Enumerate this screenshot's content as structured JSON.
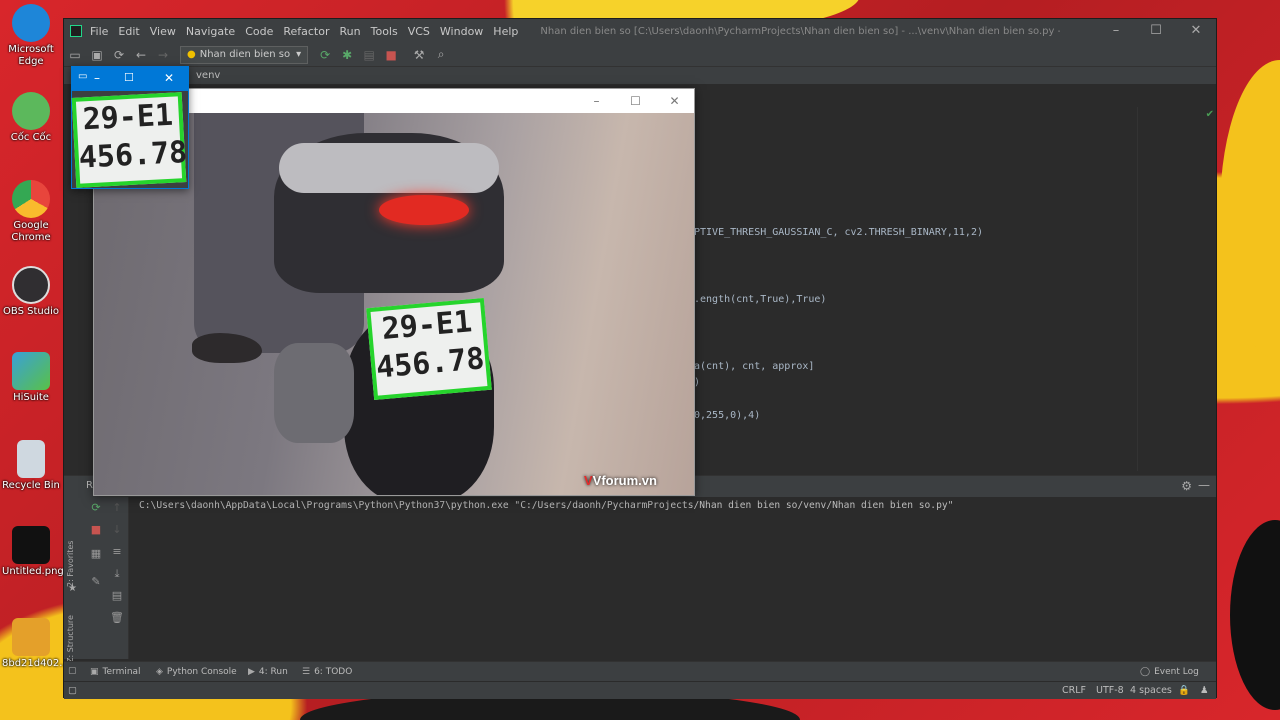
{
  "desktop": {
    "icons": [
      {
        "label": "Microsoft Edge",
        "icon": "edge-icon",
        "color": "#1e86d8"
      },
      {
        "label": "Cốc Cốc",
        "icon": "coccoc-icon",
        "color": "#5cb85c"
      },
      {
        "label": "Google Chrome",
        "icon": "chrome-icon",
        "color": "#e8453c"
      },
      {
        "label": "OBS Studio",
        "icon": "obs-icon",
        "color": "#302e31"
      },
      {
        "label": "HiSuite",
        "icon": "hisuite-icon",
        "color": "#3aa0d8"
      },
      {
        "label": "Recycle Bin",
        "icon": "recycle-bin-icon",
        "color": "#cfd8e0"
      },
      {
        "label": "Untitled.png",
        "icon": "image-file-icon",
        "color": "#111111"
      },
      {
        "label": "8bd21d402...",
        "icon": "image-file-icon",
        "color": "#e4a02a"
      }
    ]
  },
  "ide": {
    "menu": [
      "File",
      "Edit",
      "View",
      "Navigate",
      "Code",
      "Refactor",
      "Run",
      "Tools",
      "VCS",
      "Window",
      "Help"
    ],
    "window_title": "Nhan dien bien so [C:\\Users\\daonh\\PycharmProjects\\Nhan dien bien so] - ...\\venv\\Nhan dien bien so.py - PyCharm",
    "run_config": "Nhan dien bien so",
    "navbar_path": "venv",
    "code_lines": [
      {
        "text": "PTIVE_THRESH_GAUSSIAN_C, cv2.THRESH_BINARY,11,2)"
      },
      {
        "text": ".ength(cnt,True),True)"
      },
      {
        "text": "a(cnt), cnt, approx]"
      },
      {
        "text": ")"
      },
      {
        "text": "0,255,0),4)"
      }
    ],
    "console_command": "C:\\Users\\daonh\\AppData\\Local\\Programs\\Python\\Python37\\python.exe \"C:/Users/daonh/PycharmProjects/Nhan dien bien so/venv/Nhan dien bien so.py\"",
    "run_tab_label": "R",
    "side_tabs": {
      "favorites": "2: Favorites",
      "structure": "Z: Structure"
    },
    "tool_tabs": [
      {
        "label": "Terminal",
        "icon": "terminal-icon"
      },
      {
        "label": "Python Console",
        "icon": "python-console-icon"
      },
      {
        "label": "4: Run",
        "icon": "run-icon"
      },
      {
        "label": "6: TODO",
        "icon": "todo-icon"
      }
    ],
    "event_log": "Event Log",
    "status": {
      "line_sep": "CRLF",
      "encoding": "UTF-8",
      "indent": "4 spaces"
    }
  },
  "image_window": {
    "plate_line1": "29-E1",
    "plate_line2": "456.78",
    "watermark": "Vforum.vn"
  },
  "plate_window": {
    "plate_line1": "29-E1",
    "plate_line2": "456.78"
  }
}
